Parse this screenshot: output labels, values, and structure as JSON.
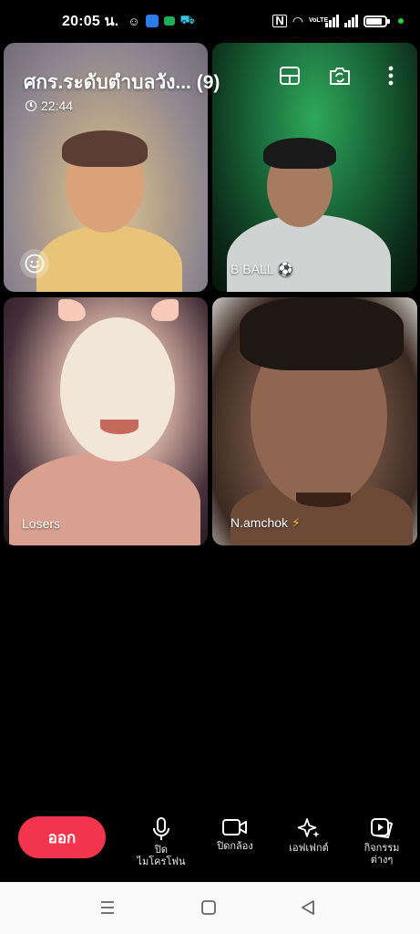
{
  "status_bar": {
    "time": "20:05 น.",
    "network": "VoLTE",
    "battery_percent": 85
  },
  "call": {
    "title": "ศกร.ระดับตำบลวัง... (9)",
    "duration": "22:44"
  },
  "participants": [
    {
      "name": "",
      "tile": "self"
    },
    {
      "name": "B BALL",
      "emoji": "⚽"
    },
    {
      "name": "Losers",
      "emoji": ""
    },
    {
      "name": "N.amchok",
      "emoji": "⚡"
    }
  ],
  "icons": {
    "layout": "layout-icon",
    "flip_camera": "flip-camera-icon",
    "more": "more-vertical-icon",
    "emoji": "smiley-icon",
    "mic": "microphone-icon",
    "camera": "video-camera-icon",
    "effects": "sparkles-icon",
    "activities": "activities-icon"
  },
  "controls": {
    "leave_label": "ออก",
    "mic_label": "ปิด\nไมโครโฟน",
    "camera_label": "ปิดกล้อง",
    "effects_label": "เอฟเฟกต์",
    "activities_label": "กิจกรรม\nต่างๆ"
  },
  "colors": {
    "leave_button": "#f2344c",
    "background": "#000000",
    "navbar": "#fafafa"
  }
}
